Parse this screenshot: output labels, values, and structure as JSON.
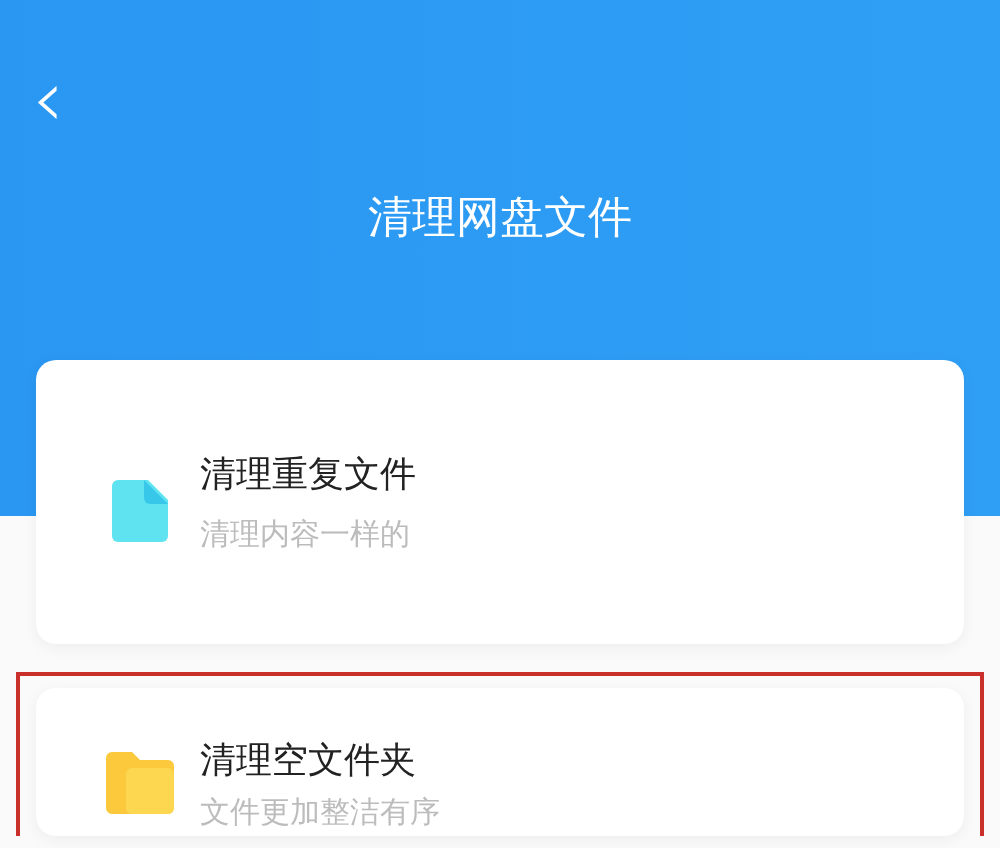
{
  "header": {
    "back_icon": "‹",
    "title": "清理网盘文件"
  },
  "options": [
    {
      "kind": "document",
      "title": "清理重复文件",
      "subtitle": "清理内容一样的",
      "highlighted": false
    },
    {
      "kind": "folder",
      "title": "清理空文件夹",
      "subtitle": "文件更加整洁有序",
      "highlighted": true
    }
  ]
}
